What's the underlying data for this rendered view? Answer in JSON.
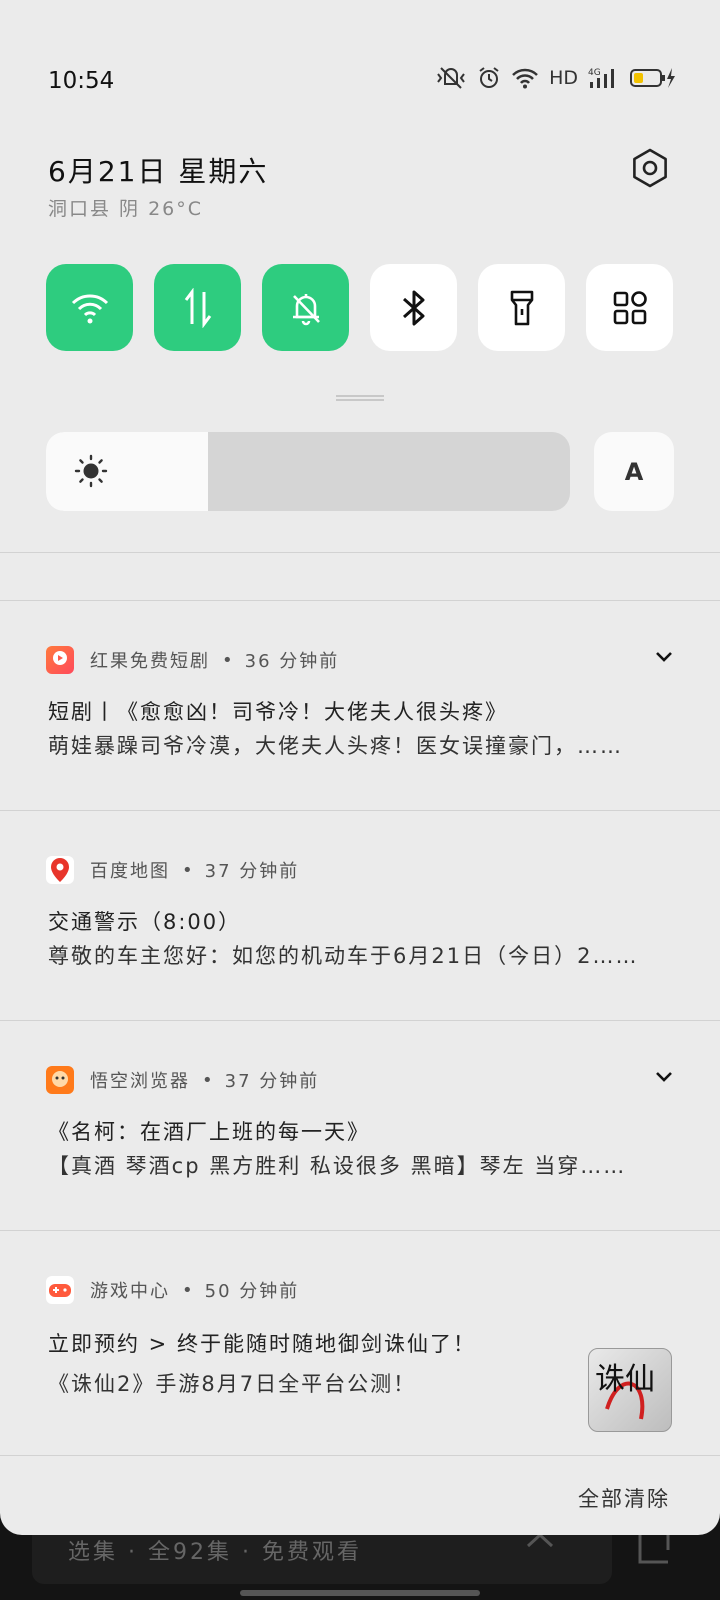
{
  "status_bar": {
    "time": "10:54",
    "network_label": "HD",
    "cell_label": "4G"
  },
  "header": {
    "date": "6月21日  星期六",
    "weather": "洞口县 阴 26°C"
  },
  "quick_tiles": [
    {
      "icon": "wifi-icon",
      "active": true
    },
    {
      "icon": "mobile-data-icon",
      "active": true
    },
    {
      "icon": "mute-bell-icon",
      "active": true
    },
    {
      "icon": "bluetooth-icon",
      "active": false
    },
    {
      "icon": "flashlight-icon",
      "active": false
    },
    {
      "icon": "more-tiles-icon",
      "active": false
    }
  ],
  "brightness": {
    "level": 0.31,
    "auto_label": "A"
  },
  "notifications": [
    {
      "app": "红果免费短剧",
      "time": "36 分钟前",
      "title": "短剧丨《愈愈凶！司爷冷！大佬夫人很头疼》",
      "text": "萌娃暴躁司爷冷漠，大佬夫人头疼！医女误撞豪门，……",
      "expandable": true
    },
    {
      "app": "百度地图",
      "time": "37 分钟前",
      "title": "交通警示（8:00）",
      "text": "尊敬的车主您好：如您的机动车于6月21日（今日）2……",
      "expandable": false
    },
    {
      "app": "悟空浏览器",
      "time": "37 分钟前",
      "title": "《名柯：在酒厂上班的每一天》",
      "text": "【真酒 琴酒cp 黑方胜利 私设很多 黑暗】琴左 当穿……",
      "expandable": true
    },
    {
      "app": "游戏中心",
      "time": "50 分钟前",
      "title": "立即预约 > 终于能随时随地御剑诛仙了！",
      "text": "《诛仙2》手游8月7日全平台公测！",
      "thumb_text": "诛仙",
      "expandable": false
    }
  ],
  "clear_all": "全部清除",
  "background_app": {
    "episode_bar": "选集 · 全92集 · 免费观看"
  },
  "colors": {
    "tile_active": "#2ecc7f",
    "shade_bg": "#ebebeb"
  }
}
